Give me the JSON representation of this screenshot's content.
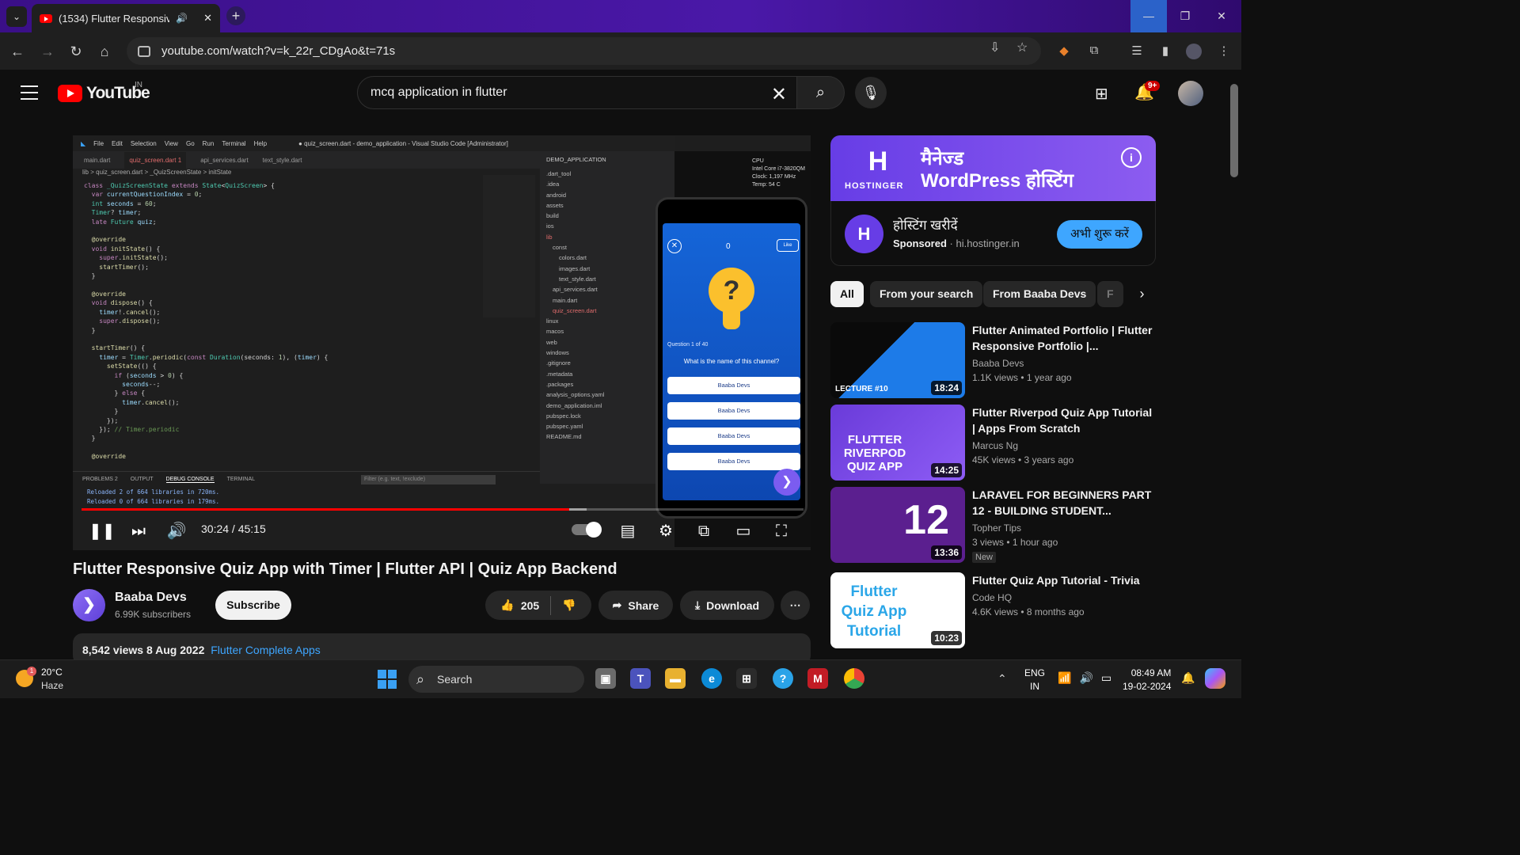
{
  "browser": {
    "tab_title": "(1534) Flutter Responsive Q",
    "new_tab": "+",
    "url": "youtube.com/watch?v=k_22r_CDgAo&t=71s",
    "window_controls": {
      "minimize": "—",
      "maximize": "❐",
      "close": "✕"
    }
  },
  "yt_header": {
    "logo_text": "YouTube",
    "country": "IN",
    "search_query": "mcq application in flutter",
    "notification_count": "9+"
  },
  "player": {
    "vscode": {
      "title_bar": [
        "File",
        "Edit",
        "Selection",
        "View",
        "Go",
        "Run",
        "Terminal",
        "Help",
        "● quiz_screen.dart - demo_application - Visual Studio Code [Administrator]"
      ],
      "tabs": [
        "main.dart",
        "quiz_screen.dart 1",
        "api_services.dart",
        "text_style.dart"
      ],
      "breadcrumb": "lib > quiz_screen.dart > _QuizScreenState > initState",
      "explorer_header": "DEMO_APPLICATION",
      "explorer_items": [
        ".dart_tool",
        ".idea",
        "android",
        "assets",
        "build",
        "ios",
        "lib",
        "const",
        "colors.dart",
        "images.dart",
        "text_style.dart",
        "api_services.dart",
        "main.dart",
        "quiz_screen.dart",
        "linux",
        "macos",
        "web",
        "windows",
        ".gitignore",
        ".metadata",
        ".packages",
        "analysis_options.yaml",
        "demo_application.iml",
        "pubspec.lock",
        "pubspec.yaml",
        "README.md"
      ],
      "terminal_tabs": [
        "PROBLEMS 2",
        "OUTPUT",
        "DEBUG CONSOLE",
        "TERMINAL"
      ],
      "terminal_filter": "Filter (e.g. text, !exclude)",
      "terminal_lines": [
        "Reloaded 2 of 664 libraries in 720ms.",
        "Reloaded 0 of 664 libraries in 179ms."
      ],
      "cpu_info": [
        "CPU",
        "Intel Core i7-3820QM",
        "Clock: 1,197 MHz",
        "Temp: 54 C"
      ]
    },
    "phone": {
      "score": "0",
      "like": "Like",
      "question_number": "Question 1 of 40",
      "question": "What is the name of this channel?",
      "options": [
        "Baaba Devs",
        "Baaba Devs",
        "Baaba Devs",
        "Baaba Devs"
      ]
    },
    "progress_fraction": 0.675,
    "buffer_fraction": 0.7,
    "time": "30:24 / 45:15"
  },
  "video": {
    "title": "Flutter Responsive Quiz App with Timer | Flutter API | Quiz App Backend",
    "channel_name": "Baaba Devs",
    "subscribers": "6.99K subscribers",
    "subscribe_label": "Subscribe",
    "likes": "205",
    "share_label": "Share",
    "download_label": "Download",
    "views_date": "8,542 views  8 Aug 2022",
    "playlist": "Flutter Complete Apps"
  },
  "ad": {
    "brand": "HOSTINGER",
    "headline_line1": "मैनेज्ड",
    "headline_line2": "WordPress होस्टिंग",
    "title": "होस्टिंग खरीदें",
    "sponsored": "Sponsored",
    "domain": "· hi.hostinger.in",
    "cta": "अभी शुरू करें"
  },
  "chips": [
    "All",
    "From your search",
    "From Baaba Devs",
    "F"
  ],
  "recommendations": [
    {
      "title": "Flutter Animated Portfolio | Flutter Responsive Portfolio |...",
      "channel": "Baaba Devs",
      "meta": "1.1K views • 1 year ago",
      "duration": "18:24",
      "thumb_text": "LECTURE #10",
      "badge": ""
    },
    {
      "title": "Flutter Riverpod Quiz App Tutorial | Apps From Scratch",
      "channel": "Marcus Ng",
      "meta": "45K views • 3 years ago",
      "duration": "14:25",
      "thumb_text": "FLUTTER RIVERPOD QUIZ APP",
      "badge": ""
    },
    {
      "title": "LARAVEL FOR BEGINNERS PART 12 - BUILDING STUDENT...",
      "channel": "Topher Tips",
      "meta": "3 views • 1 hour ago",
      "duration": "13:36",
      "thumb_text": "12",
      "badge": "New"
    },
    {
      "title": "Flutter Quiz App Tutorial - Trivia",
      "channel": "Code HQ",
      "meta": "4.6K views • 8 months ago",
      "duration": "10:23",
      "thumb_text": "Flutter Quiz App Tutorial",
      "badge": ""
    }
  ],
  "taskbar": {
    "weather_temp": "20°C",
    "weather_desc": "Haze",
    "weather_badge": "1",
    "search": "Search",
    "lang1": "ENG",
    "lang2": "IN",
    "time": "08:49 AM",
    "date": "19-02-2024"
  }
}
